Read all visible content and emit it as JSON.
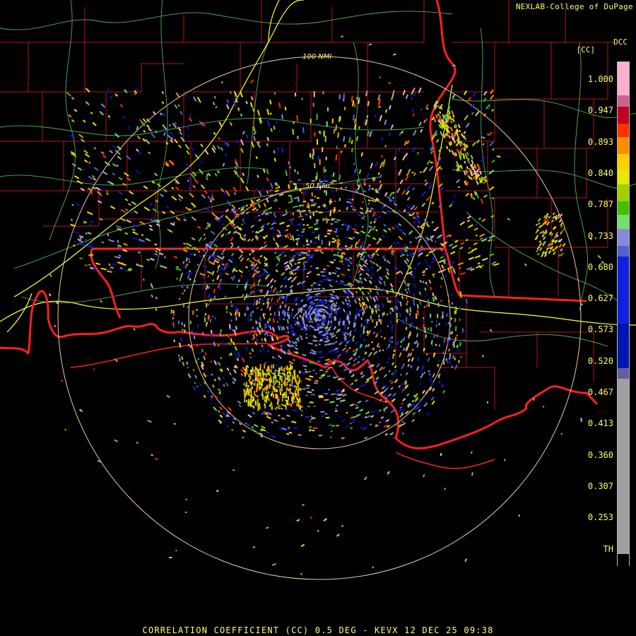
{
  "credit": "NEXLAB-College of DuPage",
  "site_label": "DCC",
  "units_label": "[CC]",
  "range_rings": [
    "100 NMI",
    "50 NMI"
  ],
  "footer": "CORRELATION COEFFICIENT (CC) 0.5 DEG - KEVX 12 DEC 25 09:38",
  "colors": {
    "state_lines": "#ff2020",
    "county_lines": "#b01818",
    "highways": "#ffff33",
    "roads": "#66cc66",
    "range_rings": "#f0c8a0",
    "text": "#ffff66"
  },
  "color_scale": {
    "ticks": [
      "1.000",
      "0.947",
      "0.893",
      "0.840",
      "0.787",
      "0.733",
      "0.680",
      "0.627",
      "0.573",
      "0.520",
      "0.467",
      "0.413",
      "0.360",
      "0.307",
      "0.253",
      "TH"
    ],
    "segments": [
      {
        "color": "#ffb0d0",
        "span": 0.06
      },
      {
        "color": "#d06090",
        "span": 0.02
      },
      {
        "color": "#c00020",
        "span": 0.03
      },
      {
        "color": "#ff3000",
        "span": 0.025
      },
      {
        "color": "#ff8c00",
        "span": 0.03
      },
      {
        "color": "#ffd000",
        "span": 0.03
      },
      {
        "color": "#e8e800",
        "span": 0.025
      },
      {
        "color": "#a0d000",
        "span": 0.03
      },
      {
        "color": "#40c000",
        "span": 0.025
      },
      {
        "color": "#70e070",
        "span": 0.025
      },
      {
        "color": "#8888dd",
        "span": 0.03
      },
      {
        "color": "#5060d0",
        "span": 0.02
      },
      {
        "color": "#1020e0",
        "span": 0.12
      },
      {
        "color": "#0018b0",
        "span": 0.08
      },
      {
        "color": "#6060a0",
        "span": 0.02
      },
      {
        "color": "#a0a0a0",
        "span": 0.315
      },
      {
        "color": "#000000",
        "span": 0.02
      }
    ]
  }
}
